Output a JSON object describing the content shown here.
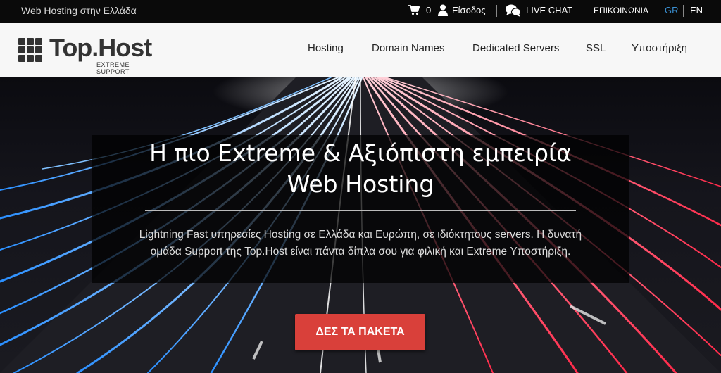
{
  "topbar": {
    "tagline": "Web Hosting στην Ελλάδα",
    "cart_icon": "shopping-cart-icon",
    "cart_count": "0",
    "user_icon": "user-icon",
    "login_label": "Είσοδος",
    "chat_icon": "chat-bubbles-icon",
    "live_chat_label": "LIVE CHAT",
    "contact_label": "ΕΠΙΚΟΙΝΩΝΙΑ",
    "lang_gr": "GR",
    "lang_en": "EN",
    "lang_active_color": "#3a8fd1"
  },
  "header": {
    "logo_text": "Top.Host",
    "logo_subtitle": "EXTREME SUPPORT",
    "nav": [
      {
        "label": "Hosting"
      },
      {
        "label": "Domain Names"
      },
      {
        "label": "Dedicated Servers"
      },
      {
        "label": "SSL"
      },
      {
        "label": "Υποστήριξη"
      }
    ]
  },
  "hero": {
    "title_line1": "Η πιο Extreme & Αξιόπιστη εμπειρία",
    "title_line2": "Web Hosting",
    "description_line1": "Lightning Fast υπηρεσίες Hosting σε Ελλάδα και Ευρώπη, σε ιδιόκτητους servers. Η δυνατή",
    "description_line2": "ομάδα Support της Top.Host είναι πάντα δίπλα σου για φιλική και Extreme Υποστήριξη.",
    "cta_label": "ΔΕΣ ΤΑ ΠΑΚΕΤΑ",
    "cta_color": "#d9403a"
  }
}
